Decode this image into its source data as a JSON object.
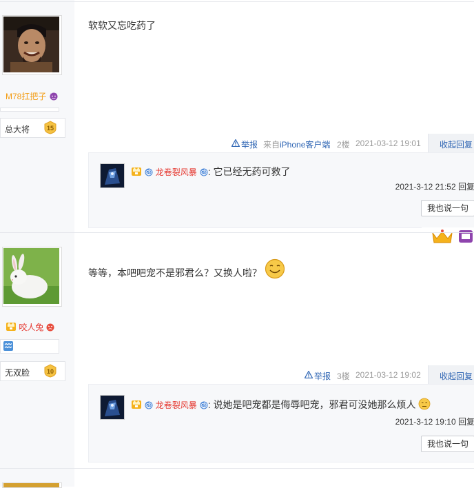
{
  "posts": [
    {
      "username": "M78扛把子",
      "level_name": "总大将",
      "level_num": "15",
      "content": "软软又忘吃药了",
      "meta": {
        "report": "举报",
        "client": "来自iPhone客户端",
        "floor": "2楼",
        "time": "2021-03-12 19:01",
        "collapse": "收起回复"
      },
      "reply": {
        "user": "龙卷裂风暴",
        "text": ":  它已经无药可救了",
        "time": "2021-3-12 21:52",
        "action": "回复",
        "say_button": "我也说一句"
      }
    },
    {
      "username": "咬人兔",
      "level_name": "无双脸",
      "level_num": "10",
      "content": "等等，本吧吧宠不是邪君么？又换人啦？",
      "meta": {
        "report": "举报",
        "floor": "3楼",
        "time": "2021-03-12 19:02",
        "collapse": "收起回复"
      },
      "reply": {
        "user": "龙卷裂风暴",
        "text": ":  说她是吧宠都是侮辱吧宠，邪君可没她那么烦人",
        "time": "2021-3-12 19:10",
        "action": "回复",
        "say_button": "我也说一句"
      }
    }
  ],
  "colors": {
    "link": "#2d64b3",
    "username_orange": "#f39c12",
    "username_red": "#e5372f",
    "level_badge": "#f5c242"
  }
}
